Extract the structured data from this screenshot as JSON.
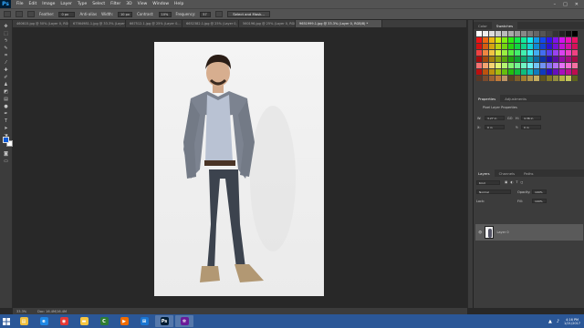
{
  "menubar": {
    "logo": "Ps",
    "items": [
      "File",
      "Edit",
      "Image",
      "Layer",
      "Type",
      "Select",
      "Filter",
      "3D",
      "View",
      "Window",
      "Help"
    ],
    "window_buttons": [
      "–",
      "□",
      "✕"
    ]
  },
  "options": {
    "feather_label": "Feather:",
    "feather_value": "0 px",
    "antialias_label": "Anti-alias",
    "width_label": "Width:",
    "width_value": "10 px",
    "contrast_label": "Contrast:",
    "contrast_value": "10%",
    "frequency_label": "Frequency:",
    "frequency_value": "57",
    "select_mask_label": "Select and Mask..."
  },
  "tabs": [
    {
      "label": "460615.jpg @ 50% (Layer 0, RGB...",
      "active": false
    },
    {
      "label": "67564981.1.jpg @ 33.3% (Layer 0, RGB...",
      "active": false
    },
    {
      "label": "667512.1.jpg @ 25% (Layer 0...",
      "active": false
    },
    {
      "label": "6652382.1.jpg @ 25% (Layer 0, RGB...",
      "active": false
    },
    {
      "label": "560196.jpg @ 25% (Layer 0, RGB...",
      "active": false
    },
    {
      "label": "9651999.1.jpg @ 33.3% (Layer 0, RGB/8) *",
      "active": true
    }
  ],
  "colors": {
    "foreground": "#0b5ad6",
    "background": "#ffffff",
    "accent": "#31a8ff",
    "taskbar": "#2b5797"
  },
  "statusbar": {
    "zoom": "33.3%",
    "doc": "Doc: 16.4M/16.4M"
  },
  "swatches_panel": {
    "tabs": [
      "Color",
      "Swatches"
    ],
    "active_tab": "Swatches"
  },
  "properties_panel": {
    "tabs": [
      "Properties",
      "Adjustments"
    ],
    "title": "Pixel Layer Properties",
    "w_label": "W:",
    "w_value": "3.27 in",
    "go_label": "GO",
    "h_label": "H:",
    "h_value": "4.36 in",
    "x_label": "X:",
    "x_value": "0 in",
    "y_label": "Y:",
    "y_value": "0 in"
  },
  "layers_panel": {
    "tabs": [
      "Layers",
      "Channels",
      "Paths"
    ],
    "kind_label": "Kind",
    "blend_mode": "Normal",
    "opacity_label": "Opacity:",
    "opacity_value": "100%",
    "lock_label": "Lock:",
    "fill_label": "Fill:",
    "fill_value": "100%",
    "layer_name": "Layer 0"
  },
  "taskbar": {
    "items": [
      {
        "icon": "explorer-icon",
        "color": "#f0c040"
      },
      {
        "icon": "ie-icon",
        "color": "#1e88e5"
      },
      {
        "icon": "chrome-icon",
        "color": "#e53935"
      },
      {
        "icon": "folder-icon",
        "color": "#f5c542"
      },
      {
        "icon": "camtasia-icon",
        "color": "#2e7d32"
      },
      {
        "icon": "mediaplayer-icon",
        "color": "#ef6c00"
      },
      {
        "icon": "windows-store-icon",
        "color": "#1976d2"
      },
      {
        "icon": "photoshop-icon",
        "color": "#001d34"
      },
      {
        "icon": "app-icon",
        "color": "#6a1b9a"
      }
    ],
    "clock_time": "4:16 PM",
    "clock_date": "1/21/2017"
  }
}
